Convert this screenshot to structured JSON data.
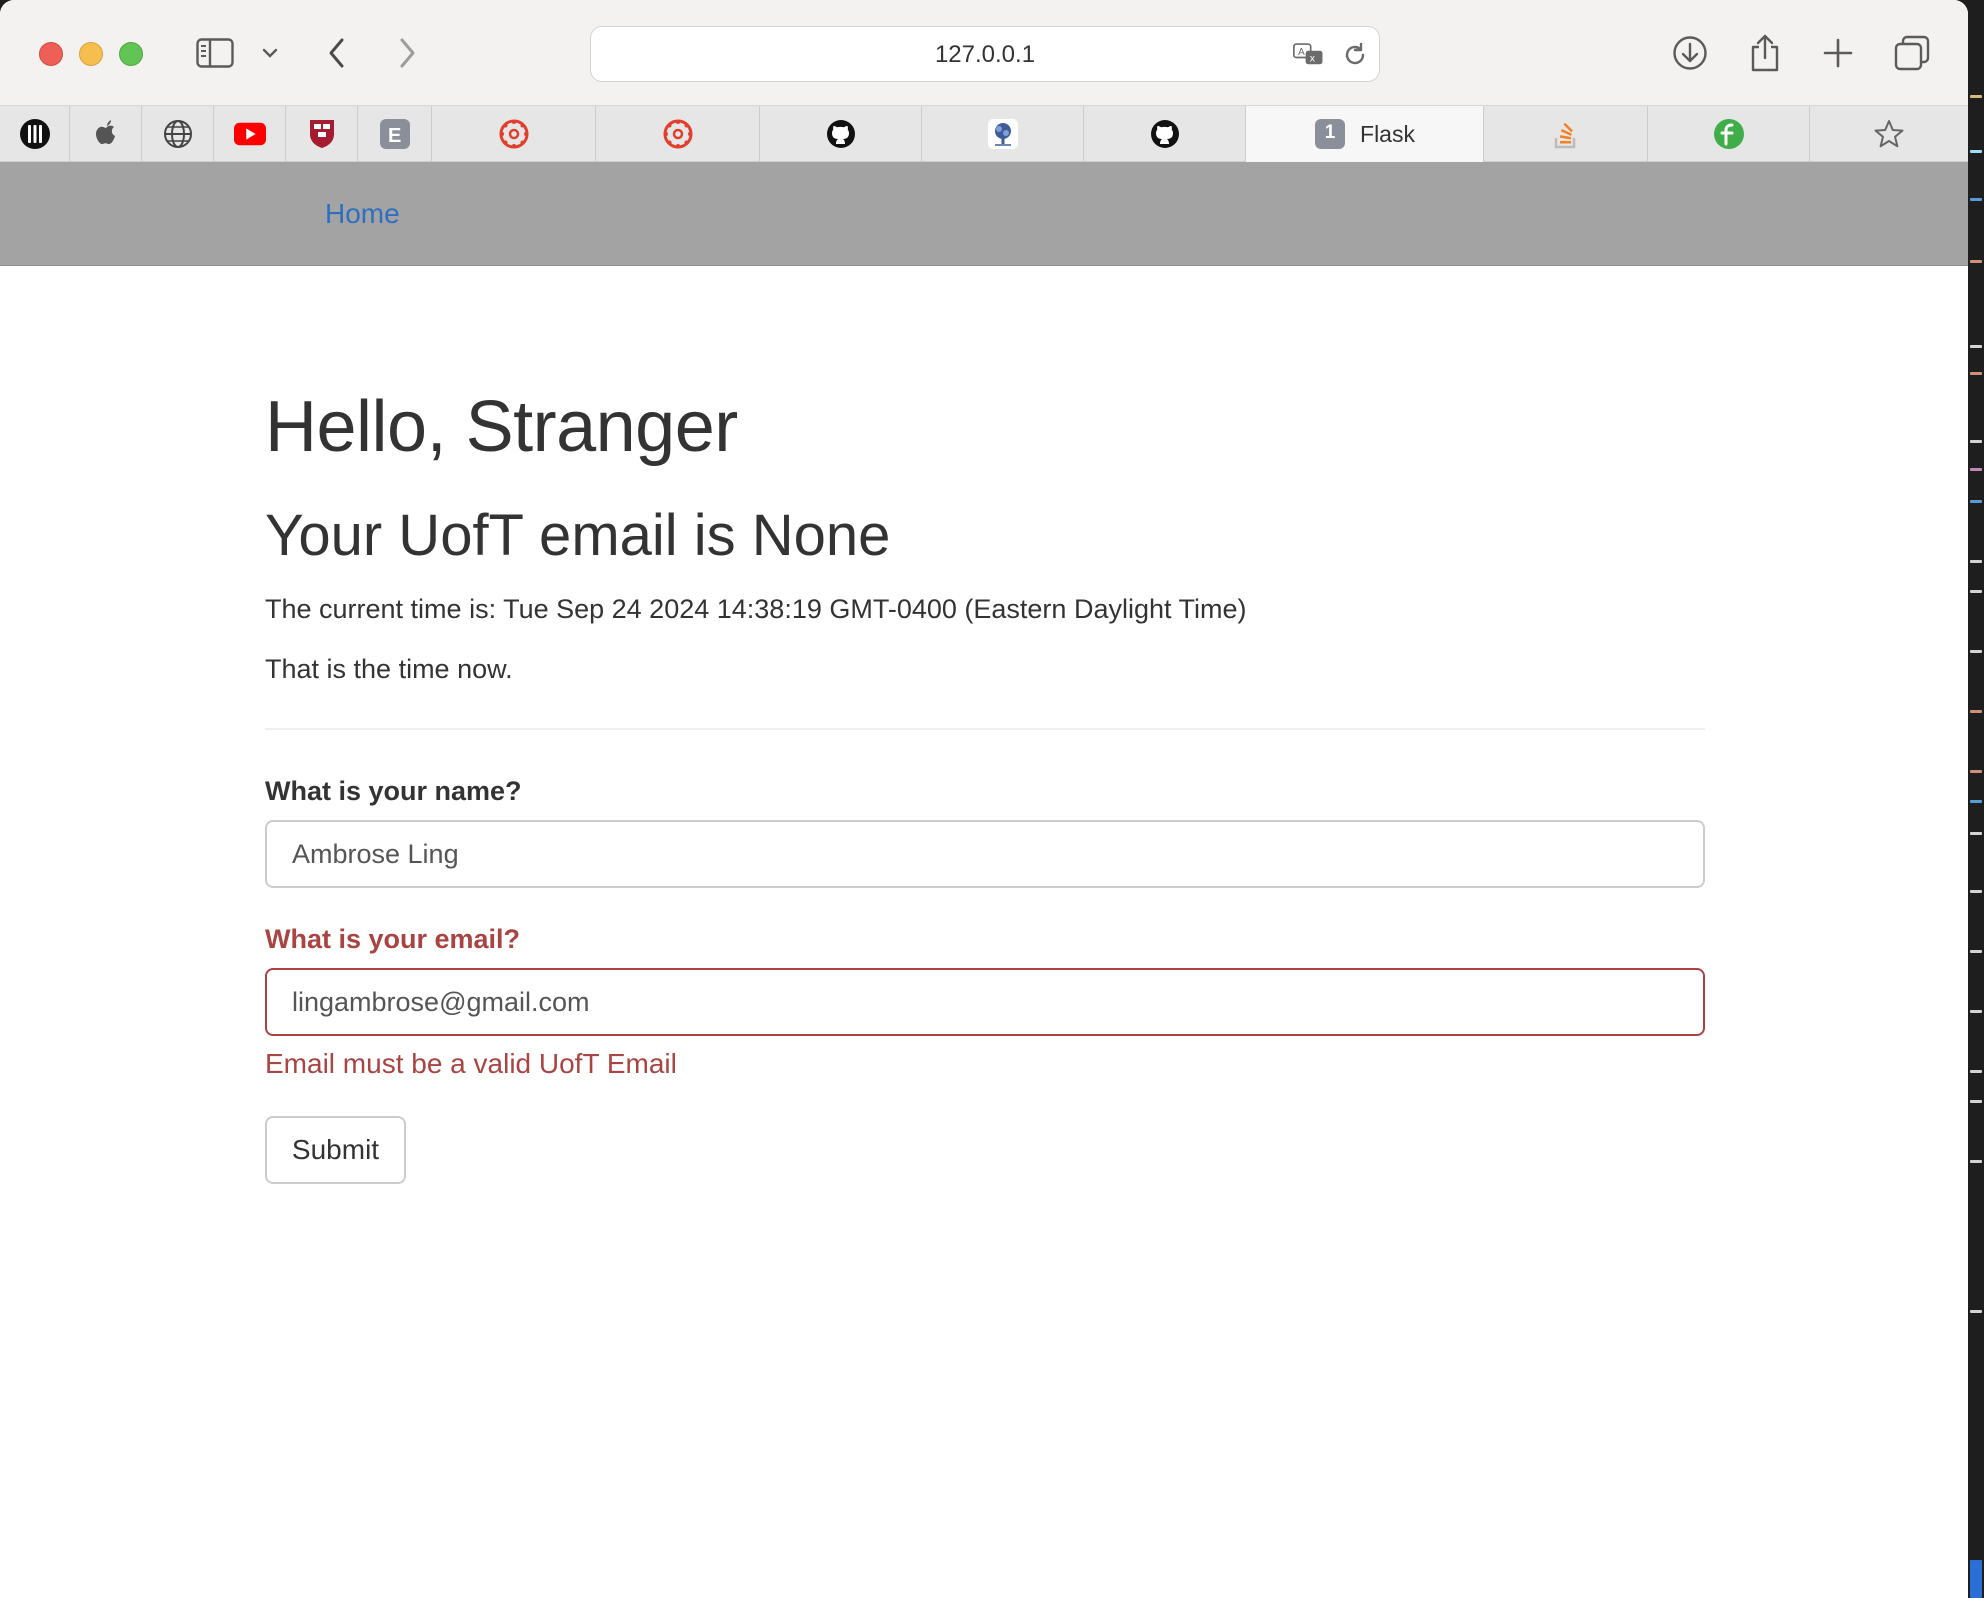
{
  "browser": {
    "url": "127.0.0.1",
    "active_tab_badge": "1",
    "active_tab_title": "Flask",
    "toolbar_icons": [
      "sidebar-icon",
      "chevron-down-icon",
      "back-icon",
      "forward-icon",
      "translate-icon",
      "reload-icon",
      "download-icon",
      "share-icon",
      "plus-icon",
      "tabs-overview-icon"
    ],
    "tab_favicons": [
      "piano-icon",
      "apple-icon",
      "globe-icon",
      "youtube-icon",
      "harvard-icon",
      "e-icon",
      "canvas-icon",
      "canvas-icon",
      "github-icon",
      "tree-icon",
      "github-icon",
      "flask-icon",
      "stackoverflow-icon",
      "leaf-icon",
      "star-icon"
    ]
  },
  "nav": {
    "home": "Home"
  },
  "page": {
    "greeting": "Hello, Stranger",
    "email_heading": "Your UofT email is None",
    "time_line": "The current time is: Tue Sep 24 2024 14:38:19 GMT-0400 (Eastern Daylight Time)",
    "time_note": "That is the time now."
  },
  "form": {
    "name_label": "What is your name?",
    "name_value": "Ambrose Ling",
    "email_label": "What is your email?",
    "email_value": "lingambrose@gmail.com",
    "email_error": "Email must be a valid UofT Email",
    "submit_label": "Submit"
  },
  "colors": {
    "error": "#a94442",
    "navbar": "#a3a3a3",
    "link": "#2f6fc2"
  }
}
